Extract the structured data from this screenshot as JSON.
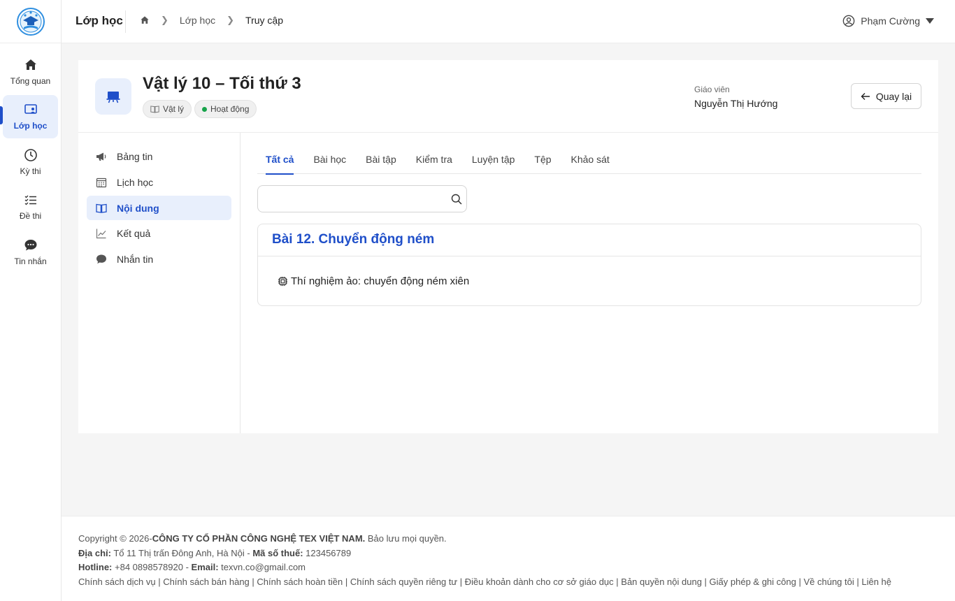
{
  "nav": {
    "items": [
      {
        "label": "Tổng quan",
        "icon": "home-icon"
      },
      {
        "label": "Lớp học",
        "icon": "classroom-icon"
      },
      {
        "label": "Kỳ thi",
        "icon": "clock-icon"
      },
      {
        "label": "Đề thi",
        "icon": "checklist-icon"
      },
      {
        "label": "Tin nhắn",
        "icon": "chat-icon"
      }
    ]
  },
  "header": {
    "title": "Lớp học",
    "breadcrumb": [
      "Lớp học",
      "Truy cập"
    ],
    "user_name": "Phạm Cường"
  },
  "class": {
    "name": "Vật lý 10 – Tối thứ 3",
    "subject_chip": "Vật lý",
    "status_chip": "Hoạt động",
    "status_color": "#16a34a",
    "teacher_label": "Giáo viên",
    "teacher_name": "Nguyễn Thị Hướng",
    "back_label": "Quay lại"
  },
  "side_menu": {
    "items": [
      {
        "label": "Bảng tin",
        "icon": "megaphone-icon"
      },
      {
        "label": "Lịch học",
        "icon": "calendar-icon"
      },
      {
        "label": "Nội dung",
        "icon": "book-icon"
      },
      {
        "label": "Kết quả",
        "icon": "chart-icon"
      },
      {
        "label": "Nhắn tin",
        "icon": "chat-icon"
      }
    ],
    "active": "Nội dung"
  },
  "content": {
    "tabs": [
      "Tất cả",
      "Bài học",
      "Bài tập",
      "Kiểm tra",
      "Luyện tập",
      "Tệp",
      "Khảo sát"
    ],
    "active_tab": "Tất cả",
    "search_value": "",
    "lesson": {
      "title": "Bài 12. Chuyển động ném",
      "items": [
        {
          "icon": "chip-icon",
          "label": "Thí nghiệm ảo: chuyển động ném xiên"
        }
      ]
    }
  },
  "footer": {
    "copyright_prefix": "Copyright © 2026-",
    "company": "CÔNG TY CỔ PHẦN CÔNG NGHỆ TEX VIỆT NAM.",
    "rights": " Bảo lưu mọi quyền.",
    "address_label": "Địa chỉ:",
    "address": " Tổ 11 Thị trấn Đông Anh, Hà Nội - ",
    "tax_label": "Mã số thuế:",
    "tax": " 123456789",
    "hotline_label": "Hotline:",
    "hotline": " +84 0898578920 - ",
    "email_label": "Email:",
    "email": " texvn.co@gmail.com",
    "links": [
      "Chính sách dịch vụ",
      "Chính sách bán hàng",
      "Chính sách hoàn tiền",
      "Chính sách quyền riêng tư",
      "Điều khoản dành cho cơ sở giáo dục",
      "Bản quyền nội dung",
      "Giấy phép & ghi công",
      "Về chúng tôi",
      "Liên hệ"
    ]
  },
  "colors": {
    "accent": "#1f4fc9",
    "accent_light": "#e8effc"
  }
}
